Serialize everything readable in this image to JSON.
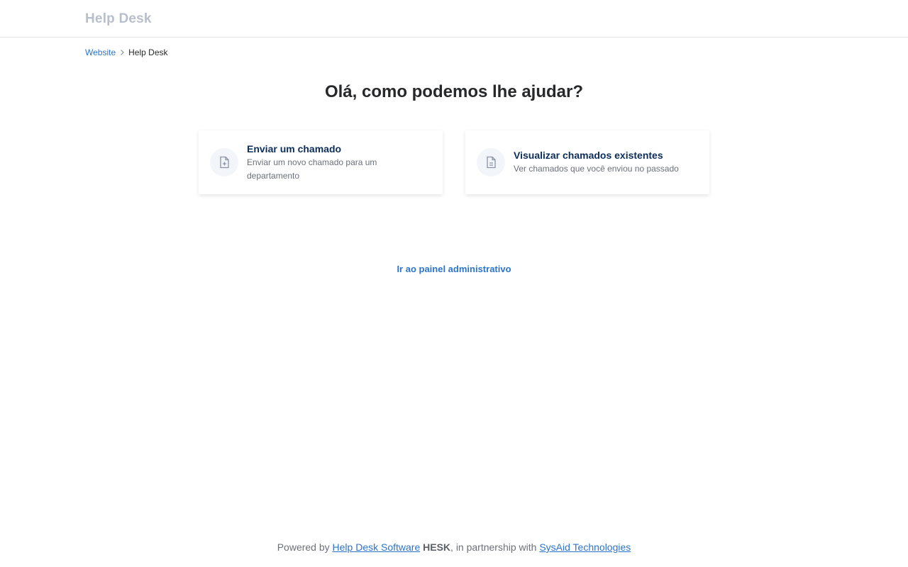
{
  "header": {
    "logo": "Help Desk"
  },
  "breadcrumb": {
    "link": "Website",
    "current": "Help Desk"
  },
  "main": {
    "headline": "Olá, como podemos lhe ajudar?",
    "cards": [
      {
        "title": "Enviar um chamado",
        "desc_line1": "Enviar um novo chamado para um",
        "desc_line2": "departamento",
        "icon": "file-plus-icon"
      },
      {
        "title": "Visualizar chamados existentes",
        "desc_line1": "Ver chamados que você enviou no passado",
        "icon": "file-text-icon"
      }
    ],
    "admin_link": "Ir ao painel administrativo"
  },
  "footer": {
    "prefix": "Powered by",
    "link1": "Help Desk Software",
    "brand": "HESK",
    "middle": ", in partnership with",
    "link2": "SysAid Technologies"
  },
  "colors": {
    "accent": "#2c74c9",
    "card_title": "#0b2d5a",
    "logo": "#b8bfcc"
  }
}
